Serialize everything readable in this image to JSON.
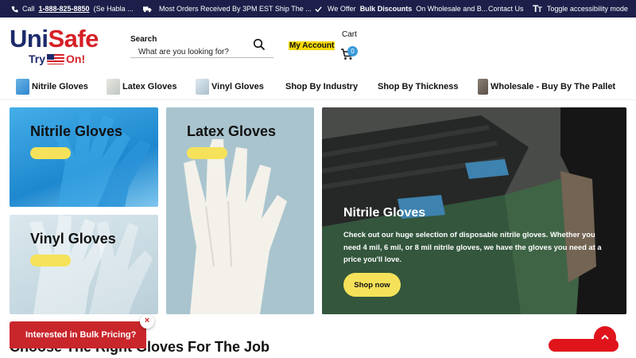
{
  "topbar": {
    "phone_prefix": "Call",
    "phone_number": "1-888-825-8850",
    "phone_suffix": "(Se Habla ...",
    "shipping_text": "Most Orders Received By 3PM EST Ship The ...",
    "discount_prefix": "We Offer",
    "discount_bold": "Bulk Discounts",
    "discount_suffix": "On Wholesale and B...",
    "contact_label": "Contact Us",
    "accessibility_label": "Toggle accessibility mode"
  },
  "header": {
    "logo_uni": "Uni",
    "logo_safe": "Safe",
    "logo_try": "Try",
    "logo_on": "On!",
    "search_label": "Search",
    "search_placeholder": "What are you looking for?",
    "my_account": "My Account",
    "cart_label": "Cart",
    "cart_count": "0"
  },
  "nav": {
    "items": [
      {
        "label": "Nitrile Gloves"
      },
      {
        "label": "Latex Gloves"
      },
      {
        "label": "Vinyl Gloves"
      },
      {
        "label": "Shop By Industry"
      },
      {
        "label": "Shop By Thickness"
      },
      {
        "label": "Wholesale - Buy By The Pallet"
      }
    ]
  },
  "tiles": [
    {
      "title": "Nitrile Gloves"
    },
    {
      "title": "Latex Gloves"
    },
    {
      "title": "Vinyl Gloves"
    }
  ],
  "hero": {
    "title": "Nitrile Gloves",
    "description": "Check out our huge selection of disposable nitrile gloves. Whether you need 4 mil, 6 mil, or 8 mil nitrile gloves, we have the gloves you need at a price you'll love.",
    "button_label": "Shop now"
  },
  "section_heading": "Choose The Right Gloves For The Job",
  "bulk_popup": {
    "label": "Interested in Bulk Pricing?",
    "close": "×"
  },
  "scroll_top": "^",
  "colors": {
    "topbar_bg": "#1d1f4a",
    "brand_blue": "#1d2a6b",
    "brand_red": "#d62027",
    "accent_yellow": "#f5e25a",
    "badge_blue": "#3a9ad9"
  }
}
